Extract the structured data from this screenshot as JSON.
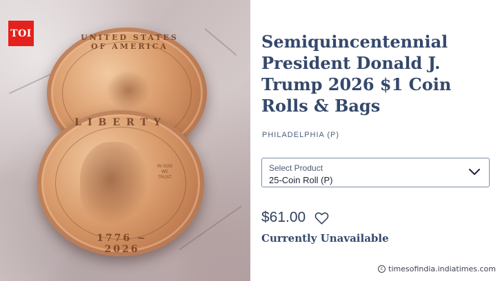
{
  "logo": {
    "text": "TOI",
    "color": "#e4211c"
  },
  "photo": {
    "coin_back_legend": "UNITED STATES OF AMERICA",
    "coin_front_legend": "LIBERTY",
    "coin_front_years": "1776 ~ 2026",
    "coin_motto": "IN GOD WE TRUST"
  },
  "product": {
    "title": "Semiquincentennial President Donald J. Trump 2026 $1 Coin Rolls & Bags",
    "mint": "PHILADELPHIA (P)",
    "select": {
      "label": "Select Product",
      "value": "25-Coin Roll (P)",
      "icon": "chevron-down-icon"
    },
    "price": "$61.00",
    "wishlist_icon": "heart-icon",
    "availability": "Currently Unavailable"
  },
  "colors": {
    "title": "#34486b",
    "select_border": "#7b8aa8",
    "price": "#2f3f5e"
  },
  "watermark": {
    "text": "timesofindia.indiatimes.com"
  }
}
